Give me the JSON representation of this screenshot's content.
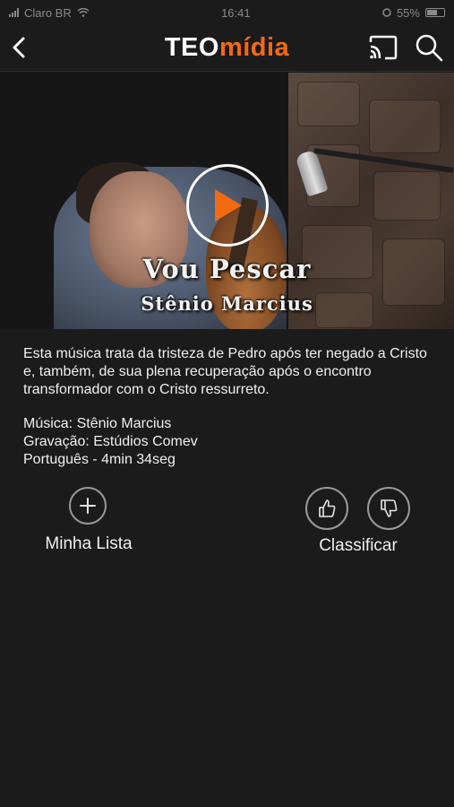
{
  "status_bar": {
    "carrier": "Claro BR",
    "time": "16:41",
    "battery": "55%"
  },
  "header": {
    "logo_part1": "TEO",
    "logo_part2": "mídia",
    "accent_color": "#f26a12"
  },
  "video": {
    "title": "Vou Pescar",
    "artist": "Stênio Marcius"
  },
  "description": "Esta música trata da tristeza de Pedro após ter negado a Cristo e, também, de sua plena recuperação após o encontro transformador com o Cristo ressurreto.",
  "details": {
    "music": "Música: Stênio Marcius",
    "recording": "Gravação: Estúdios Comev",
    "language_duration": "Português - 4min 34seg"
  },
  "actions": {
    "my_list_label": "Minha Lista",
    "rate_label": "Classificar"
  }
}
